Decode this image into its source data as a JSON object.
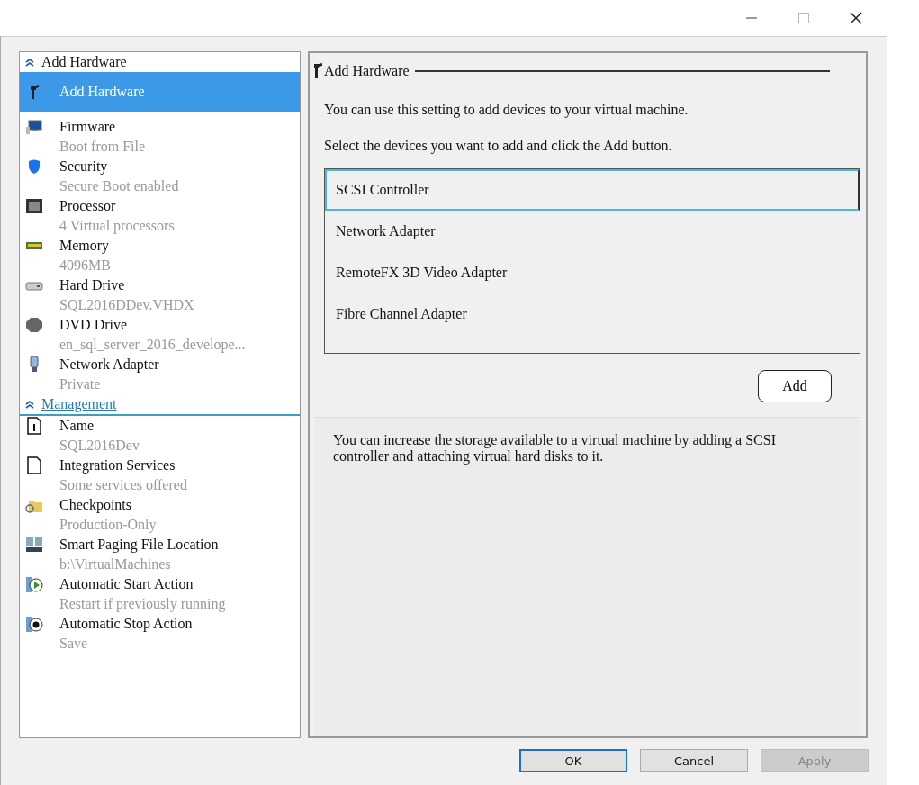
{
  "sidebar": {
    "sections": [
      {
        "title": "Add Hardware",
        "expanded": true,
        "items": [
          {
            "name": "Add Hardware",
            "selected": true
          },
          {
            "name": "Firmware",
            "detail": "Boot from File",
            "selected": false
          },
          {
            "name": "Security",
            "detail": "Secure Boot enabled",
            "selected": false
          },
          {
            "name": "Processor",
            "detail": "4 Virtual processors",
            "selected": false
          },
          {
            "name": "Memory",
            "detail": "4096MB",
            "selected": false
          },
          {
            "name": "Hard Drive",
            "detail": "SQL2016DDev.VHDX",
            "selected": false
          },
          {
            "name": "DVD Drive",
            "detail": "en_sql_server_2016_develope...",
            "selected": false
          },
          {
            "name": "Network Adapter",
            "detail": "Private",
            "selected": false
          }
        ]
      },
      {
        "title": "Management",
        "expanded": true,
        "items": [
          {
            "name": "Name",
            "detail": "SQL2016Dev",
            "selected": false
          },
          {
            "name": "Integration Services",
            "detail": "Some services offered",
            "selected": false
          },
          {
            "name": "Checkpoints",
            "detail": "Production-Only",
            "selected": false
          },
          {
            "name": "Smart Paging File Location",
            "detail": "b:\\VirtualMachines",
            "selected": false
          },
          {
            "name": "Automatic Start Action",
            "detail": "Restart if previously running",
            "selected": false
          },
          {
            "name": "Automatic Stop Action",
            "detail": "Save",
            "selected": false
          }
        ]
      }
    ]
  },
  "panel": {
    "title": "Add Hardware",
    "intro": "You can use this setting to add devices to your virtual machine.",
    "instruction": "Select the devices you want to add and click the Add button.",
    "devices": [
      {
        "label": "SCSI Controller",
        "selected": true
      },
      {
        "label": "Network Adapter",
        "selected": false
      },
      {
        "label": "RemoteFX 3D Video Adapter",
        "selected": false
      },
      {
        "label": "Fibre Channel Adapter",
        "selected": false
      }
    ],
    "add_button": "Add",
    "description": "You can increase the storage available to a virtual machine by adding a SCSI controller and attaching virtual hard disks to it."
  },
  "buttons": [
    {
      "label": "OK",
      "default": true,
      "disabled": false
    },
    {
      "label": "Cancel",
      "default": false,
      "disabled": false
    },
    {
      "label": "Apply",
      "default": false,
      "disabled": true
    }
  ]
}
